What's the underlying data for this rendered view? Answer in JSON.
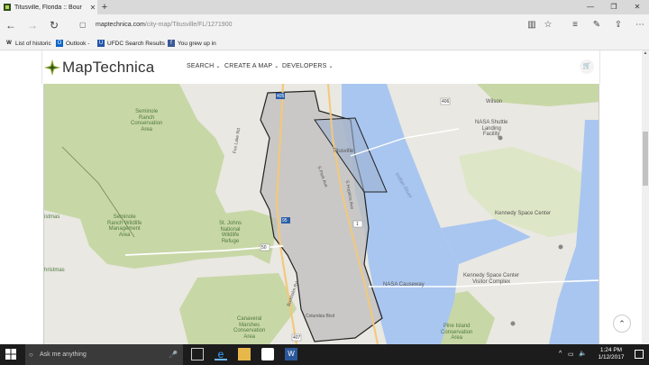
{
  "browser": {
    "tab_title": "Titusville, Florida :: Bour",
    "new_tab_symbol": "+",
    "window_controls": [
      "—",
      "❐",
      "✕"
    ],
    "url_host": "maptechnica.com",
    "url_path": "/city-map/Titusville/FL/1271900"
  },
  "favorites": [
    {
      "label": "List of historic",
      "icon": "wikipedia-icon",
      "color": "#222222"
    },
    {
      "label": "Outlook -",
      "icon": "outlook-icon",
      "color": "#0a64c8"
    },
    {
      "label": "UFDC Search Results",
      "icon": "ufdc-icon",
      "color": "#2255aa"
    },
    {
      "label": "You grew up in",
      "icon": "facebook-icon",
      "color": "#3b5998"
    }
  ],
  "site": {
    "logo_text": "MapTechnica",
    "menu": [
      "SEARCH",
      "CREATE A MAP",
      "DEVELOPERS"
    ],
    "accent": "#8aa531"
  },
  "map": {
    "city_labels": [
      {
        "text": "Titusville",
        "kind": "gray"
      },
      {
        "text": "Wilson",
        "kind": "gray"
      },
      {
        "text": "Kennedy Space Center",
        "kind": "gray"
      }
    ],
    "poi_labels": [
      {
        "text": "NASA Shuttle\nLanding\nFacility",
        "kind": "gray"
      },
      {
        "text": "Kennedy Space Center\nVisitor Complex",
        "kind": "gray"
      },
      {
        "text": "NASA Causeway",
        "kind": "gray"
      }
    ],
    "park_labels": [
      {
        "text": "Seminole\nRanch\nConservation\nArea",
        "kind": "green"
      },
      {
        "text": "Seminole\nRanch Wildlife\nManagement\nArea",
        "kind": "green"
      },
      {
        "text": "St. Johns\nNational\nWildlife\nRefuge",
        "kind": "green"
      },
      {
        "text": "Canaveral\nMarshes\nConservation\nArea",
        "kind": "green"
      },
      {
        "text": "Pine Island\nConservation\nArea",
        "kind": "green"
      },
      {
        "text": "istmas",
        "kind": "green"
      },
      {
        "text": "hristmas",
        "kind": "green"
      }
    ],
    "water_labels": [
      {
        "text": "Indian River",
        "kind": "blue"
      }
    ],
    "street_labels": [
      "S Park Ave",
      "S Hopkins Ave",
      "Fox Lake Rd",
      "Burkholm Rd",
      "Columbia Blvd"
    ],
    "road_shields": [
      "405",
      "95",
      "1",
      "50",
      "407",
      "406",
      "402",
      "405"
    ],
    "colors": {
      "land": "#e9e8e2",
      "park": "#c8d7a6",
      "water": "#a9c6f0",
      "boundary_fill": "#bdbdbd",
      "highway": "#f3c87a"
    }
  },
  "taskbar": {
    "search_placeholder": "Ask me anything",
    "time": "1:24 PM",
    "date": "1/12/2017"
  }
}
